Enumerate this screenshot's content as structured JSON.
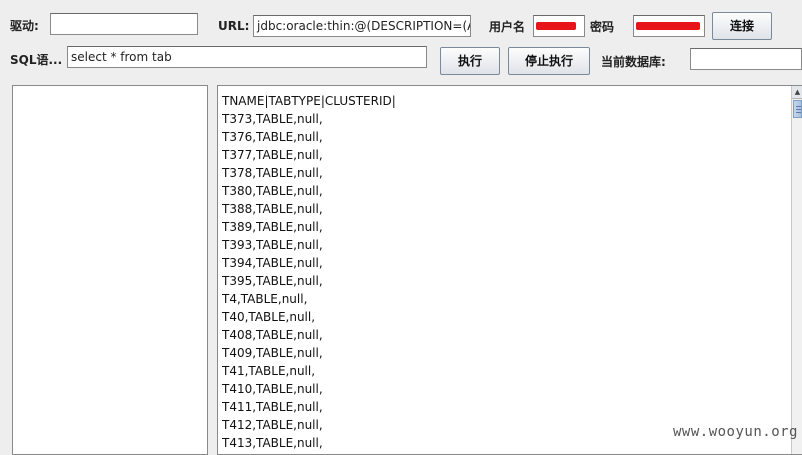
{
  "toolbar": {
    "driver_label": "驱动:",
    "driver_value": "",
    "url_label": "URL:",
    "url_value": "jdbc:oracle:thin:@(DESCRIPTION=(ADDRESS",
    "username_label": "用户名",
    "username_value": "",
    "password_label": "密码",
    "password_value": "",
    "connect_label": "连接",
    "sql_label": "SQL语...",
    "sql_value": "select * from tab",
    "execute_label": "执行",
    "stop_label": "停止执行",
    "current_db_label": "当前数据库:",
    "current_db_value": ""
  },
  "result": {
    "lines": [
      "TNAME|TABTYPE|CLUSTERID|",
      "T373,TABLE,null,",
      "T376,TABLE,null,",
      "T377,TABLE,null,",
      "T378,TABLE,null,",
      "T380,TABLE,null,",
      "T388,TABLE,null,",
      "T389,TABLE,null,",
      "T393,TABLE,null,",
      "T394,TABLE,null,",
      "T395,TABLE,null,",
      "T4,TABLE,null,",
      "T40,TABLE,null,",
      "T408,TABLE,null,",
      "T409,TABLE,null,",
      "T41,TABLE,null,",
      "T410,TABLE,null,",
      "T411,TABLE,null,",
      "T412,TABLE,null,",
      "T413,TABLE,null,"
    ]
  },
  "watermark": "www.wooyun.org",
  "colors": {
    "redaction": "#e8141a",
    "panel_bg": "#ffffff",
    "window_bg": "#eeeeee"
  },
  "icons": {
    "scroll_up": "scroll-up-arrow-icon"
  }
}
